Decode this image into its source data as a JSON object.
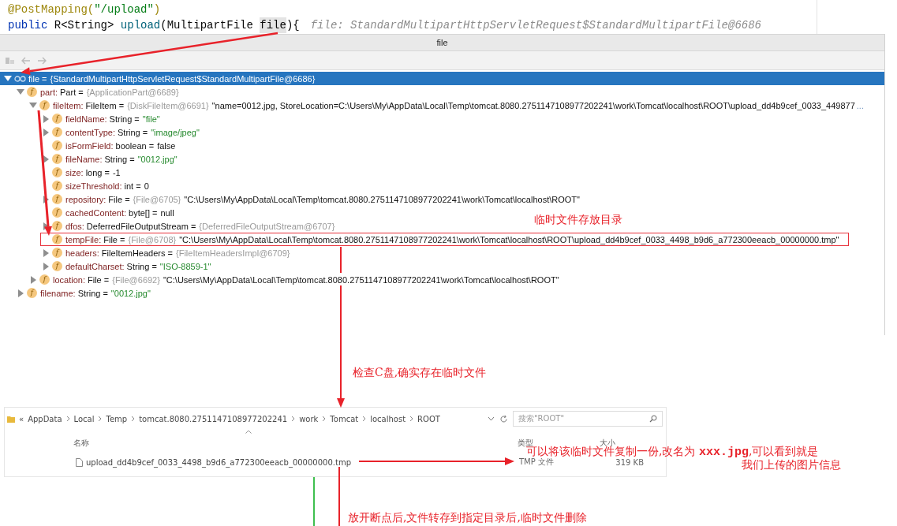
{
  "code": {
    "lines": [
      [
        {
          "kind": "annotation",
          "text": "@PostMapping("
        },
        {
          "kind": "string",
          "text": "\"/upload\""
        },
        {
          "kind": "annotation",
          "text": ")"
        }
      ],
      [
        {
          "kind": "keyword",
          "text": "public "
        },
        {
          "kind": "plain",
          "text": "R<String> "
        },
        {
          "kind": "method",
          "text": "upload"
        },
        {
          "kind": "plain",
          "text": "(MultipartFile "
        },
        {
          "kind": "highlight",
          "text": "file"
        },
        {
          "kind": "plain",
          "text": "){"
        },
        {
          "kind": "hint",
          "text": "file: StandardMultipartHttpServletRequest$StandardMultipartFile@6686"
        }
      ]
    ]
  },
  "debugger": {
    "title": "file",
    "toolbar": [
      {
        "kind": "layout",
        "disabled": true
      },
      {
        "kind": "back",
        "disabled": true
      },
      {
        "kind": "forward",
        "disabled": true
      }
    ],
    "tree": [
      {
        "kind": "variable",
        "name": "file",
        "type": "=",
        "ref": "{StandardMultipartHttpServletRequest$StandardMultipartFile@6686}",
        "selected": true,
        "boxed": false,
        "expanded": true,
        "children": [
          {
            "kind": "field",
            "badge": "f",
            "name": "part:",
            "type": "Part  =",
            "ref": "{ApplicationPart@6689}",
            "selected": false,
            "boxed": false,
            "expanded": true,
            "children": [
              {
                "kind": "field",
                "badge": "f",
                "name": "fileItem:",
                "type": "FileItem  =",
                "ref": "{DiskFileItem@6691}",
                "value": {
                  "kind": "plain",
                  "text": "\"name=0012.jpg, StoreLocation=C:\\Users\\My\\AppData\\Local\\Temp\\tomcat.8080.2751147108977202241\\work\\Tomcat\\localhost\\ROOT\\upload_dd4b9cef_0033_449877"
                },
                "more": "...",
                "selected": false,
                "boxed": false,
                "expanded": true,
                "children": [
                  {
                    "kind": "field",
                    "badge": "f",
                    "name": "fieldName:",
                    "type": "String  =",
                    "value": {
                      "kind": "string",
                      "text": "\"file\""
                    },
                    "selected": false,
                    "boxed": false,
                    "expanded": false
                  },
                  {
                    "kind": "field",
                    "badge": "f",
                    "name": "contentType:",
                    "type": "String  =",
                    "value": {
                      "kind": "string",
                      "text": "\"image/jpeg\""
                    },
                    "selected": false,
                    "boxed": false,
                    "expanded": false
                  },
                  {
                    "kind": "field",
                    "badge": "f",
                    "name": "isFormField:",
                    "type": "boolean  =",
                    "value": {
                      "kind": "plain",
                      "text": "false"
                    },
                    "selected": false,
                    "boxed": false
                  },
                  {
                    "kind": "field",
                    "badge": "f",
                    "name": "fileName:",
                    "type": "String  =",
                    "value": {
                      "kind": "string",
                      "text": "\"0012.jpg\""
                    },
                    "selected": false,
                    "boxed": false,
                    "expanded": false
                  },
                  {
                    "kind": "field",
                    "badge": "f",
                    "name": "size:",
                    "type": "long  =",
                    "value": {
                      "kind": "plain",
                      "text": "-1"
                    },
                    "selected": false,
                    "boxed": false
                  },
                  {
                    "kind": "field",
                    "badge": "f",
                    "name": "sizeThreshold:",
                    "type": "int  =",
                    "value": {
                      "kind": "plain",
                      "text": "0"
                    },
                    "selected": false,
                    "boxed": false
                  },
                  {
                    "kind": "field",
                    "badge": "f",
                    "name": "repository:",
                    "type": "File  =",
                    "ref": "{File@6705}",
                    "value": {
                      "kind": "plain",
                      "text": "\"C:\\Users\\My\\AppData\\Local\\Temp\\tomcat.8080.2751147108977202241\\work\\Tomcat\\localhost\\ROOT\""
                    },
                    "selected": false,
                    "boxed": false,
                    "expanded": false
                  },
                  {
                    "kind": "field",
                    "badge": "f",
                    "name": "cachedContent:",
                    "type": "byte[]  =",
                    "value": {
                      "kind": "plain",
                      "text": "null"
                    },
                    "selected": false,
                    "boxed": false
                  },
                  {
                    "kind": "field",
                    "badge": "f",
                    "name": "dfos:",
                    "type": "DeferredFileOutputStream  =",
                    "ref": "{DeferredFileOutputStream@6707}",
                    "selected": false,
                    "boxed": false,
                    "expanded": false
                  },
                  {
                    "kind": "field",
                    "badge": "f",
                    "name": "tempFile:",
                    "type": "File  =",
                    "ref": "{File@6708}",
                    "value": {
                      "kind": "plain",
                      "text": "\"C:\\Users\\My\\AppData\\Local\\Temp\\tomcat.8080.2751147108977202241\\work\\Tomcat\\localhost\\ROOT\\upload_dd4b9cef_0033_4498_b9d6_a772300eeacb_00000000.tmp\""
                    },
                    "selected": false,
                    "boxed": true
                  },
                  {
                    "kind": "field",
                    "badge": "f",
                    "name": "headers:",
                    "type": "FileItemHeaders  =",
                    "ref": "{FileItemHeadersImpl@6709}",
                    "selected": false,
                    "boxed": false,
                    "expanded": false
                  },
                  {
                    "kind": "field",
                    "badge": "f",
                    "name": "defaultCharset:",
                    "type": "String  =",
                    "value": {
                      "kind": "string",
                      "text": "\"ISO-8859-1\""
                    },
                    "selected": false,
                    "boxed": false,
                    "expanded": false
                  }
                ]
              },
              {
                "kind": "field",
                "badge": "f",
                "name": "location:",
                "type": "File  =",
                "ref": "{File@6692}",
                "value": {
                  "kind": "plain",
                  "text": "\"C:\\Users\\My\\AppData\\Local\\Temp\\tomcat.8080.2751147108977202241\\work\\Tomcat\\localhost\\ROOT\""
                },
                "selected": false,
                "boxed": false,
                "expanded": false
              }
            ]
          },
          {
            "kind": "field",
            "badge": "f",
            "name": "filename:",
            "type": "String  =",
            "value": {
              "kind": "string",
              "text": "\"0012.jpg\""
            },
            "selected": false,
            "boxed": false,
            "expanded": false
          }
        ]
      }
    ]
  },
  "explorer": {
    "overflow_mark": "«",
    "breadcrumb": [
      "AppData",
      "Local",
      "Temp",
      "tomcat.8080.2751147108977202241",
      "work",
      "Tomcat",
      "localhost",
      "ROOT"
    ],
    "search": {
      "placeholder": "搜索\"ROOT\""
    },
    "columns": [
      {
        "label": "名称",
        "sorted": true
      },
      {
        "label": "类型",
        "sorted": false
      },
      {
        "label": "大小",
        "sorted": false
      }
    ],
    "rows": [
      {
        "name": "upload_dd4b9cef_0033_4498_b9d6_a772300eeacb_00000000.tmp",
        "type": "TMP 文件",
        "size": "319 KB"
      }
    ]
  },
  "annotations": [
    {
      "text": "临时文件存放目录"
    },
    {
      "text": "检查C盘,确实存在临时文件"
    },
    {
      "text": "可以将该临时文件复制一份,改名为 **xxx.jpg**,可以看到就是"
    },
    {
      "text": "我们上传的图片信息"
    },
    {
      "text": "放开断点后,文件转存到指定目录后,临时文件删除"
    }
  ]
}
